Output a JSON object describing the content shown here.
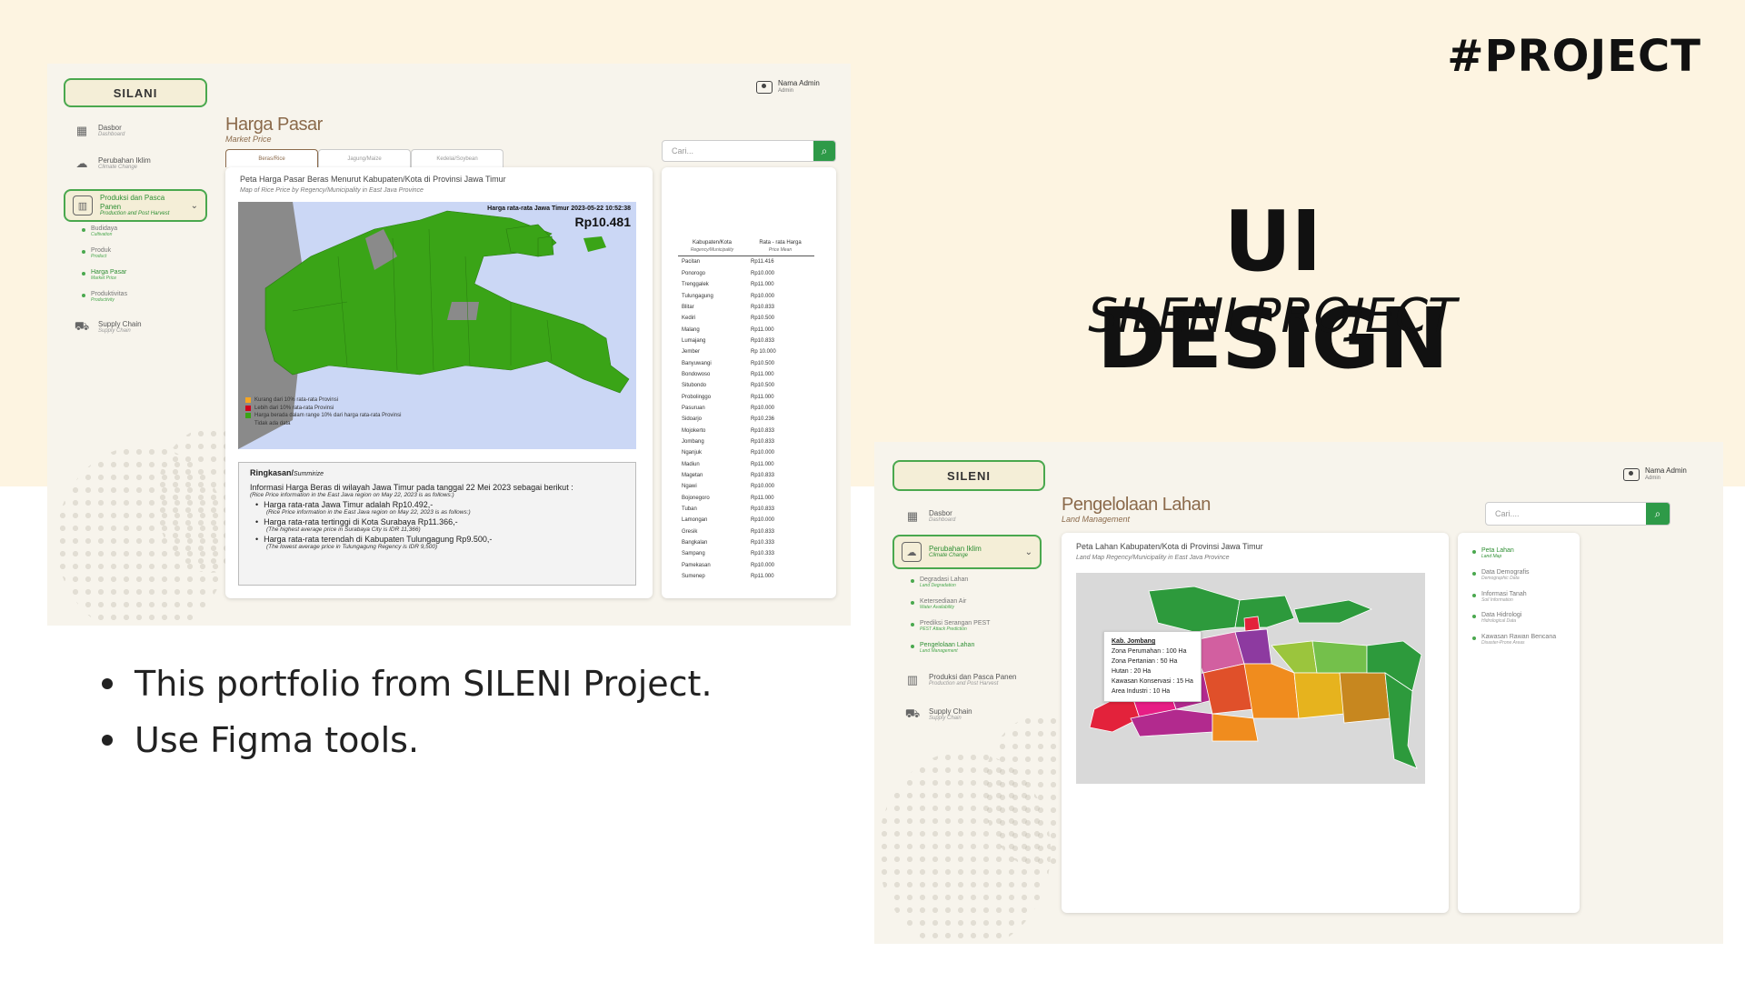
{
  "hero": {
    "tag": "#PROJECT",
    "title": "UI DESIGN",
    "subtitle": "SILENI PROJECT"
  },
  "bullets": [
    "This portfolio from SILENI Project.",
    "Use Figma tools."
  ],
  "shot_market": {
    "logo": "SILANI",
    "admin": {
      "name": "Nama Admin",
      "role": "Admin"
    },
    "nav": [
      {
        "label": "Dasbor",
        "sub": "Dashboard",
        "icon": "grid-icon"
      },
      {
        "label": "Perubahan Iklim",
        "sub": "Climate Change",
        "icon": "cloud-sun-icon"
      }
    ],
    "nav_active": {
      "label": "Produksi dan Pasca Panen",
      "sub": "Production and Post Harvest",
      "icon": "chart-icon"
    },
    "sub_items": [
      {
        "label": "Budidaya",
        "sub": "Cultivation"
      },
      {
        "label": "Produk",
        "sub": "Product"
      },
      {
        "label": "Harga Pasar",
        "sub": "Market Price"
      },
      {
        "label": "Produktivitas",
        "sub": "Productivity"
      }
    ],
    "nav_bottom": {
      "label": "Supply Chain",
      "sub": "Supply Chain",
      "icon": "truck-icon"
    },
    "page_title": "Harga Pasar",
    "page_sub": "Market Price",
    "tabs": [
      "Beras/Rice",
      "Jagung/Maize",
      "Kedelai/Soybean"
    ],
    "search_placeholder": "Cari...",
    "map_title": "Peta Harga Pasar Beras Menurut Kabupaten/Kota di Provinsi Jawa Timur",
    "map_sub": "Map of Rice Price by Regency/Municipality in East Java Province",
    "avg_label": "Harga rata-rata Jawa Timur 2023-05-22 10:52:38",
    "avg_value": "Rp10.481",
    "legend": [
      {
        "label": "Kurang dari 10% rata-rata Provinsi",
        "color": "#f5a623"
      },
      {
        "label": "Lebih dari 10% rata-rata Provinsi",
        "color": "#d0021b"
      },
      {
        "label": "Harga berada dalam range 10% dari harga rata-rata Provinsi",
        "color": "#3aa417"
      },
      {
        "label": "Tidak ada data",
        "color": "#8a8a8a"
      }
    ],
    "summary": {
      "heading": "Ringkasan/",
      "heading_en": "Summirize",
      "intro": "Informasi Harga Beras di wilayah Jawa Timur pada tanggal 22 Mei 2023 sebagai berikut :",
      "intro_en": "(Rice Price information in the East Java region on May 22, 2023 is as follows:)",
      "points": [
        {
          "text": "Harga rata-rata Jawa Timur adalah Rp10.492,-",
          "en": "(Rice Price information in the East Java region on May 22, 2023 is as follows:)"
        },
        {
          "text": "Harga rata-rata tertinggi di Kota Surabaya Rp11.366,-",
          "en": "(The highest average price in Surabaya City is IDR 11,366)"
        },
        {
          "text": "Harga rata-rata terendah di Kabupaten Tulungagung Rp9.500,-",
          "en": "(The lowest average price in Tulungagung Regency is IDR 9,500)"
        }
      ]
    },
    "table": {
      "col1": "Kabupaten/Kota",
      "col1_en": "Regency/Municipality",
      "col2": "Rata - rata Harga",
      "col2_en": "Price Mean",
      "rows": [
        [
          "Pacitan",
          "Rp11.416"
        ],
        [
          "Ponorogo",
          "Rp10.000"
        ],
        [
          "Trenggalek",
          "Rp11.000"
        ],
        [
          "Tulungagung",
          "Rp10.000"
        ],
        [
          "Blitar",
          "Rp10.833"
        ],
        [
          "Kediri",
          "Rp10.500"
        ],
        [
          "Malang",
          "Rp11.000"
        ],
        [
          "Lumajang",
          "Rp10.833"
        ],
        [
          "Jember",
          "Rp 10.000"
        ],
        [
          "Banyuwangi",
          "Rp10.500"
        ],
        [
          "Bondowoso",
          "Rp11.000"
        ],
        [
          "Situbondo",
          "Rp10.500"
        ],
        [
          "Probolinggo",
          "Rp11.000"
        ],
        [
          "Pasuruan",
          "Rp10.000"
        ],
        [
          "Sidoarjo",
          "Rp10.236"
        ],
        [
          "Mojokerto",
          "Rp10.833"
        ],
        [
          "Jombang",
          "Rp10.833"
        ],
        [
          "Nganjuk",
          "Rp10.000"
        ],
        [
          "Madiun",
          "Rp11.000"
        ],
        [
          "Magetan",
          "Rp10.833"
        ],
        [
          "Ngawi",
          "Rp10.000"
        ],
        [
          "Bojonegoro",
          "Rp11.000"
        ],
        [
          "Tuban",
          "Rp10.833"
        ],
        [
          "Lamongan",
          "Rp10.000"
        ],
        [
          "Gresik",
          "Rp10.833"
        ],
        [
          "Bangkalan",
          "Rp10.333"
        ],
        [
          "Sampang",
          "Rp10.333"
        ],
        [
          "Pamekasan",
          "Rp10.000"
        ],
        [
          "Sumenep",
          "Rp11.000"
        ]
      ]
    }
  },
  "shot_land": {
    "logo": "SILENI",
    "admin": {
      "name": "Nama Admin",
      "role": "Admin"
    },
    "nav": [
      {
        "label": "Dasbor",
        "sub": "Dashboard",
        "icon": "grid-icon"
      }
    ],
    "nav_active": {
      "label": "Perubahan Iklim",
      "sub": "Climate Change",
      "icon": "cloud-sun-icon"
    },
    "sub_items": [
      {
        "label": "Degradasi Lahan",
        "sub": "Land Degradation"
      },
      {
        "label": "Ketersediaan Air",
        "sub": "Water Availability"
      },
      {
        "label": "Prediksi Serangan PEST",
        "sub": "PEST Attack Prediction"
      },
      {
        "label": "Pengelolaan Lahan",
        "sub": "Land Management"
      }
    ],
    "nav_bottom": [
      {
        "label": "Produksi dan Pasca Panen",
        "sub": "Production and Post Harvest",
        "icon": "chart-icon"
      },
      {
        "label": "Supply Chain",
        "sub": "Supply Chain",
        "icon": "truck-icon"
      }
    ],
    "page_title": "Pengelolaan Lahan",
    "page_sub": "Land Management",
    "search_placeholder": "Cari....",
    "map_title": "Peta Lahan Kabupaten/Kota di Provinsi Jawa Timur",
    "map_sub": "Land Map Regency/Municipality in East Java Province",
    "tooltip": {
      "title": "Kab. Jombang",
      "lines": [
        "Zona Perumahan : 100 Ha",
        "Zona Pertanian : 50 Ha",
        "Hutan : 20 Ha",
        "Kawasan Konservasi : 15 Ha",
        "Area Industri : 10 Ha"
      ]
    },
    "right_list": [
      {
        "label": "Peta Lahan",
        "sub": "Land Map"
      },
      {
        "label": "Data Demografis",
        "sub": "Demographic Data"
      },
      {
        "label": "Informasi Tanah",
        "sub": "Soil Information"
      },
      {
        "label": "Data Hidrologi",
        "sub": "Hidrological Data"
      },
      {
        "label": "Kawasan Rawan Bencana",
        "sub": "Disaster-Prone Areas"
      }
    ]
  }
}
